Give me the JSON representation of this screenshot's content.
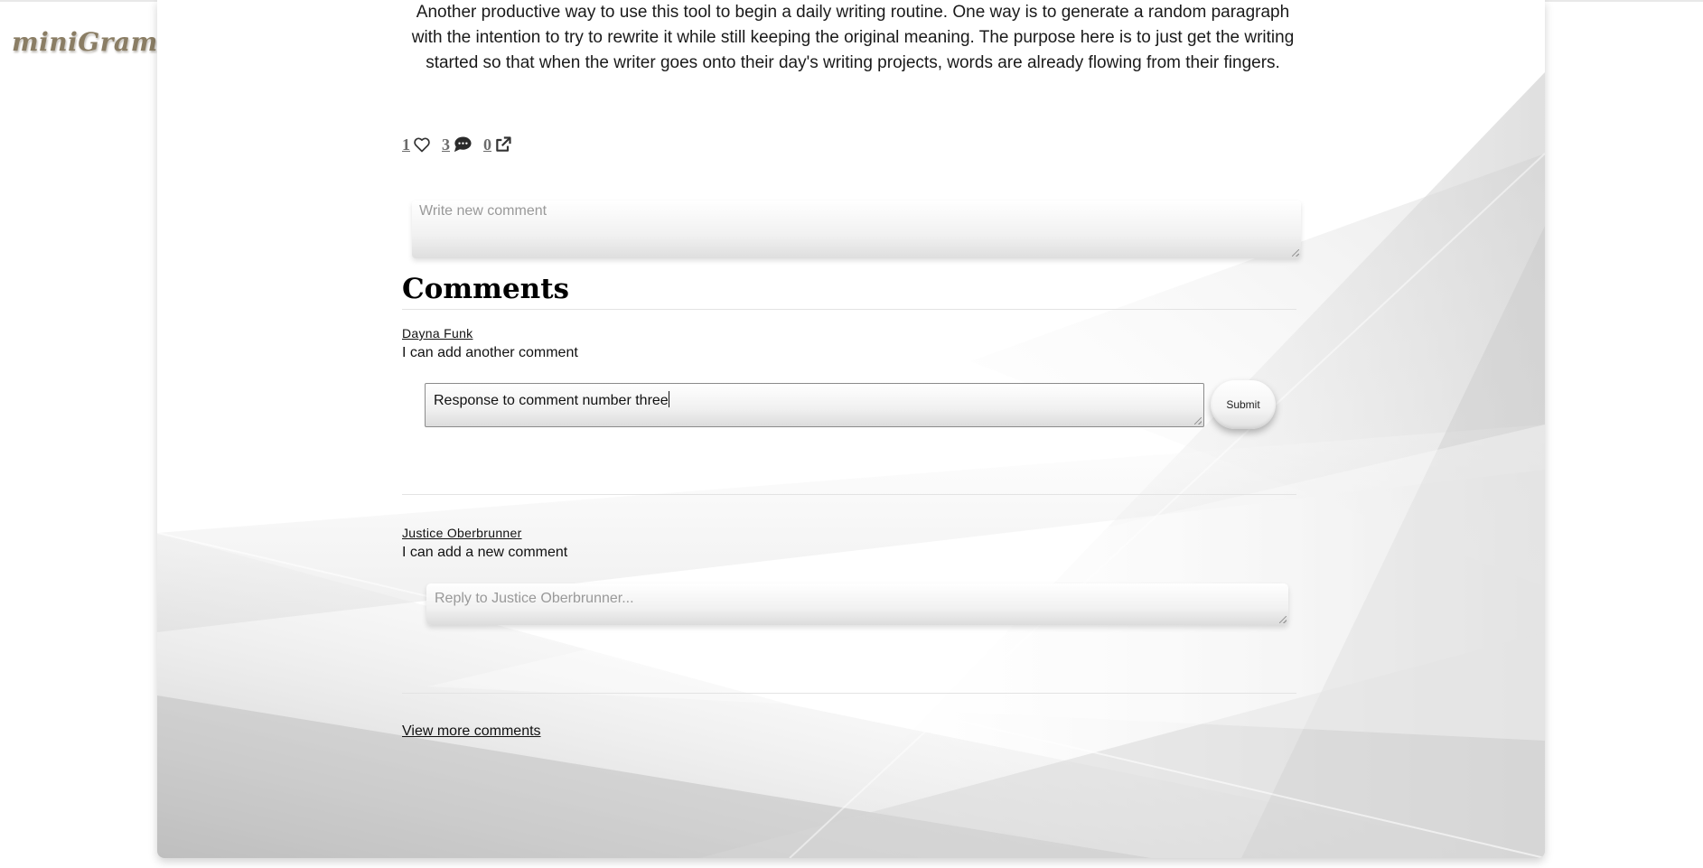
{
  "app": {
    "logo": "miniGram"
  },
  "post": {
    "body": "Another productive way to use this tool to begin a daily writing routine. One way is to generate a random paragraph with the intention to try to rewrite it while still keeping the original meaning. The purpose here is to just get the writing started so that when the writer goes onto their day's writing projects, words are already flowing from their fingers.",
    "likes": "1",
    "comments_count": "3",
    "shares": "0"
  },
  "new_comment": {
    "placeholder": "Write new comment"
  },
  "comments_section": {
    "heading": "Comments",
    "items": [
      {
        "author": "Dayna Funk",
        "text": "I can add another comment",
        "reply_value": "Response to comment number three",
        "submit_label": "Submit"
      },
      {
        "author": "Justice Oberbrunner",
        "text": "I can add a new comment",
        "reply_placeholder": "Reply to Justice Oberbrunner..."
      }
    ],
    "view_more": "View more comments"
  },
  "icons": {
    "like": "heart-icon",
    "comment": "speech-bubble-icon",
    "share": "external-link-icon"
  }
}
